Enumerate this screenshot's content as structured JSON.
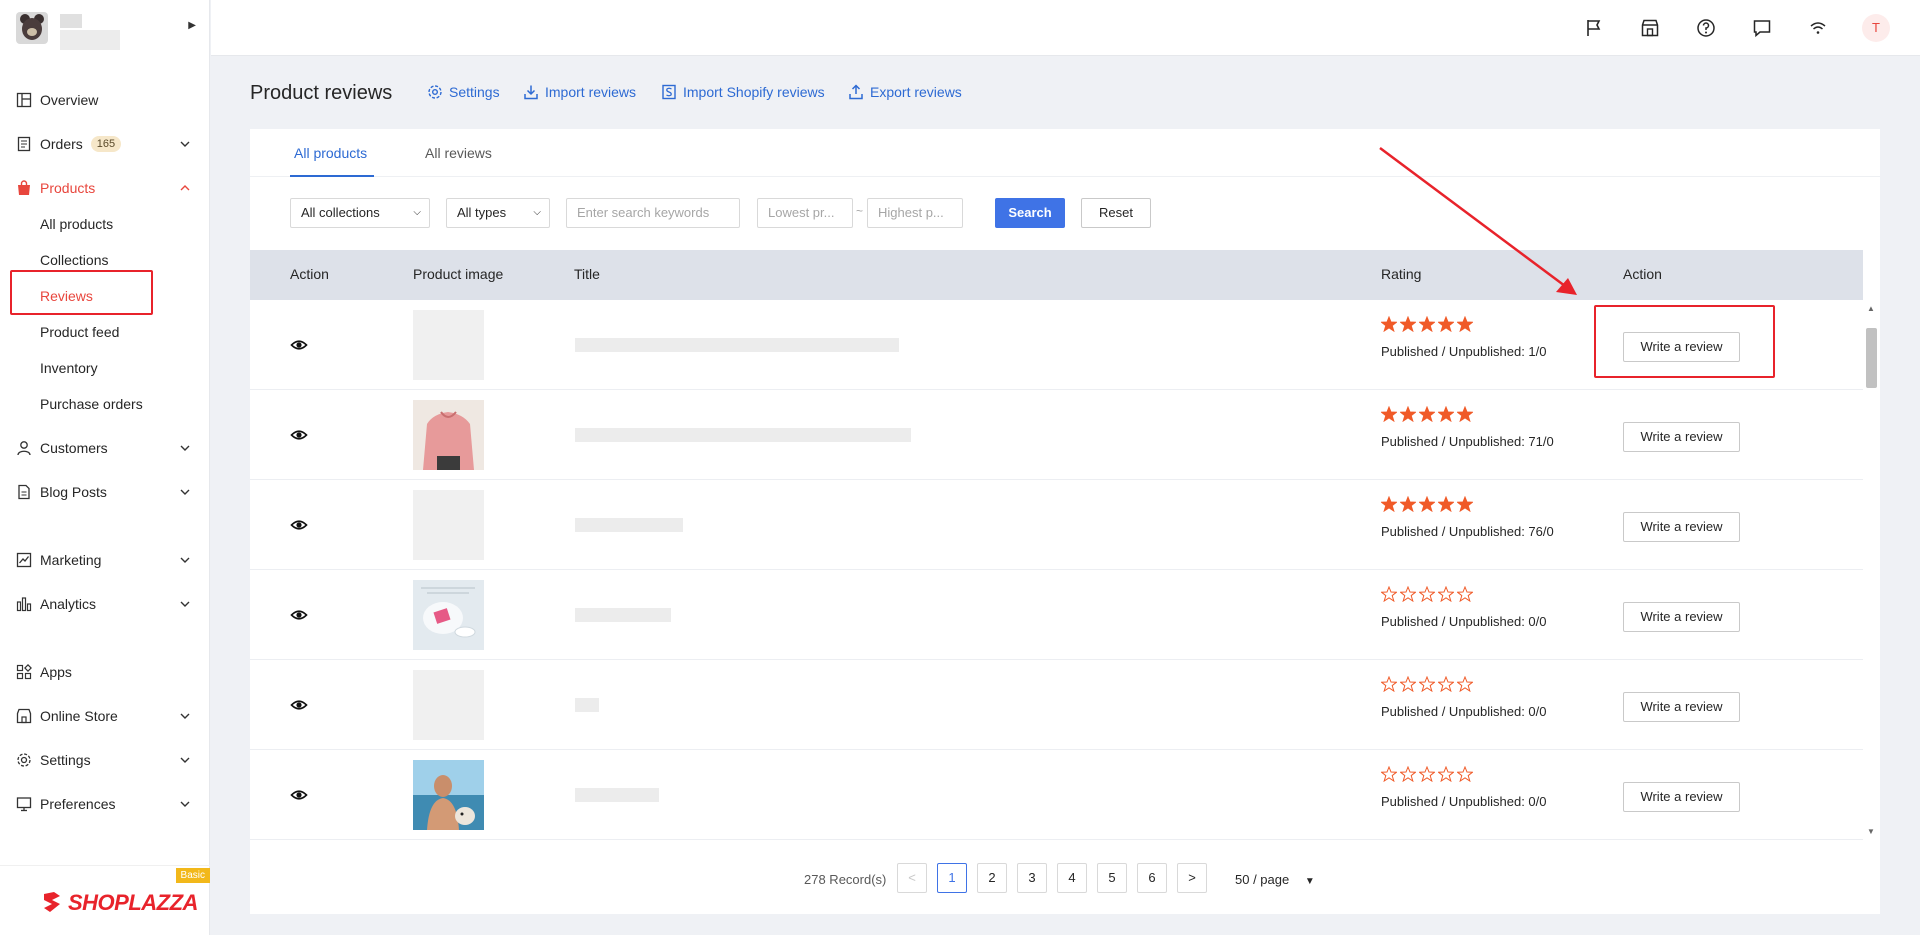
{
  "sidebar": {
    "nav": [
      {
        "label": "Overview",
        "icon": "overview-icon"
      },
      {
        "label": "Orders",
        "icon": "orders-icon",
        "badge": "165"
      },
      {
        "label": "Products",
        "icon": "products-icon"
      },
      {
        "label": "Customers",
        "icon": "customers-icon"
      },
      {
        "label": "Blog Posts",
        "icon": "blog-posts-icon"
      },
      {
        "label": "Marketing",
        "icon": "marketing-icon"
      },
      {
        "label": "Analytics",
        "icon": "analytics-icon"
      },
      {
        "label": "Apps",
        "icon": "apps-icon"
      },
      {
        "label": "Online Store",
        "icon": "online-store-icon"
      },
      {
        "label": "Settings",
        "icon": "settings-icon"
      },
      {
        "label": "Preferences",
        "icon": "preferences-icon"
      }
    ],
    "products_sub": [
      "All products",
      "Collections",
      "Reviews",
      "Product feed",
      "Inventory",
      "Purchase orders"
    ],
    "brand": {
      "name": "SHOPLAZZA",
      "plan": "Basic"
    }
  },
  "topbar": {
    "avatar": "T"
  },
  "header": {
    "title": "Product reviews",
    "links": [
      "Settings",
      "Import reviews",
      "Import Shopify reviews",
      "Export reviews"
    ]
  },
  "tabs": [
    "All products",
    "All reviews"
  ],
  "filters": {
    "collections": "All collections",
    "types": "All types",
    "search_placeholder": "Enter search keywords",
    "lowest_placeholder": "Lowest pr...",
    "highest_placeholder": "Highest p...",
    "range_sep": "~",
    "search_label": "Search",
    "reset_label": "Reset"
  },
  "table": {
    "headers": {
      "action": "Action",
      "image": "Product image",
      "title": "Title",
      "rating": "Rating",
      "action2": "Action"
    },
    "rows": [
      {
        "stars": 5,
        "published": "Published / Unpublished: 1/0",
        "button": "Write a review"
      },
      {
        "stars": 5,
        "published": "Published / Unpublished: 71/0",
        "button": "Write a review"
      },
      {
        "stars": 5,
        "published": "Published / Unpublished: 76/0",
        "button": "Write a review"
      },
      {
        "stars": 0,
        "published": "Published / Unpublished: 0/0",
        "button": "Write a review"
      },
      {
        "stars": 0,
        "published": "Published / Unpublished: 0/0",
        "button": "Write a review"
      },
      {
        "stars": 0,
        "published": "Published / Unpublished: 0/0",
        "button": "Write a review"
      }
    ]
  },
  "pagination": {
    "records": "278 Record(s)",
    "pages": [
      "1",
      "2",
      "3",
      "4",
      "5",
      "6"
    ],
    "prev": "<",
    "next": ">",
    "per_page": "50 / page"
  },
  "colors": {
    "accent": "#2d6ad3",
    "primary_button": "#3f73e6",
    "star": "#f05a28",
    "active_nav": "#e8463d",
    "annotation": "#e8232b"
  }
}
